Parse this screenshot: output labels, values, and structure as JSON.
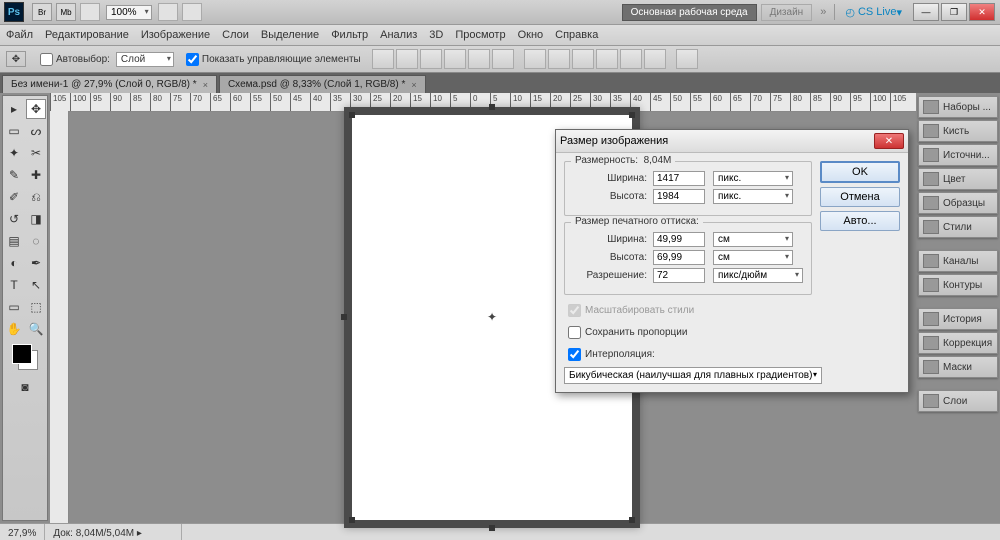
{
  "titlebar": {
    "zoom": "100%",
    "workspace_main": "Основная рабочая среда",
    "workspace_design": "Дизайн",
    "cslive": "CS Live"
  },
  "menu": {
    "file": "Файл",
    "edit": "Редактирование",
    "image": "Изображение",
    "layer": "Слои",
    "select": "Выделение",
    "filter": "Фильтр",
    "analysis": "Анализ",
    "3d": "3D",
    "view": "Просмотр",
    "window": "Окно",
    "help": "Справка"
  },
  "options": {
    "autoselect": "Автовыбор:",
    "autoselect_val": "Слой",
    "show_controls": "Показать управляющие элементы"
  },
  "tabs": {
    "tab1": "Без имени-1 @ 27,9% (Слой 0, RGB/8) *",
    "tab2": "Схема.psd @ 8,33% (Слой 1, RGB/8) *"
  },
  "ruler_ticks": [
    "105",
    "100",
    "95",
    "90",
    "85",
    "80",
    "75",
    "70",
    "65",
    "60",
    "55",
    "50",
    "45",
    "40",
    "35",
    "30",
    "25",
    "20",
    "15",
    "10",
    "5",
    "0",
    "5",
    "10",
    "15",
    "20",
    "25",
    "30",
    "35",
    "40",
    "45",
    "50",
    "55",
    "60",
    "65",
    "70",
    "75",
    "80",
    "85",
    "90",
    "95",
    "100",
    "105"
  ],
  "panels": {
    "sets": "Наборы ...",
    "brush": "Кисть",
    "sources": "Источни...",
    "color": "Цвет",
    "swatches": "Образцы",
    "styles": "Стили",
    "channels": "Каналы",
    "paths": "Контуры",
    "history": "История",
    "adjust": "Коррекция",
    "masks": "Маски",
    "layers": "Слои"
  },
  "status": {
    "zoom": "27,9%",
    "docsize": "Док: 8,04M/5,04M"
  },
  "dialog": {
    "title": "Размер изображения",
    "dim_label": "Размерность:",
    "dim_value": "8,04M",
    "width_label": "Ширина:",
    "width_value": "1417",
    "height_label": "Высота:",
    "height_value": "1984",
    "unit_px": "пикс.",
    "print_label": "Размер печатного оттиска:",
    "pwidth": "49,99",
    "pheight": "69,99",
    "res_label": "Разрешение:",
    "res_value": "72",
    "unit_cm": "см",
    "unit_ppi": "пикс/дюйм",
    "scale_styles": "Масштабировать стили",
    "keep_prop": "Сохранить пропорции",
    "interp_label": "Интерполяция:",
    "interp_value": "Бикубическая (наилучшая для плавных градиентов)",
    "ok": "OK",
    "cancel": "Отмена",
    "auto": "Авто..."
  }
}
